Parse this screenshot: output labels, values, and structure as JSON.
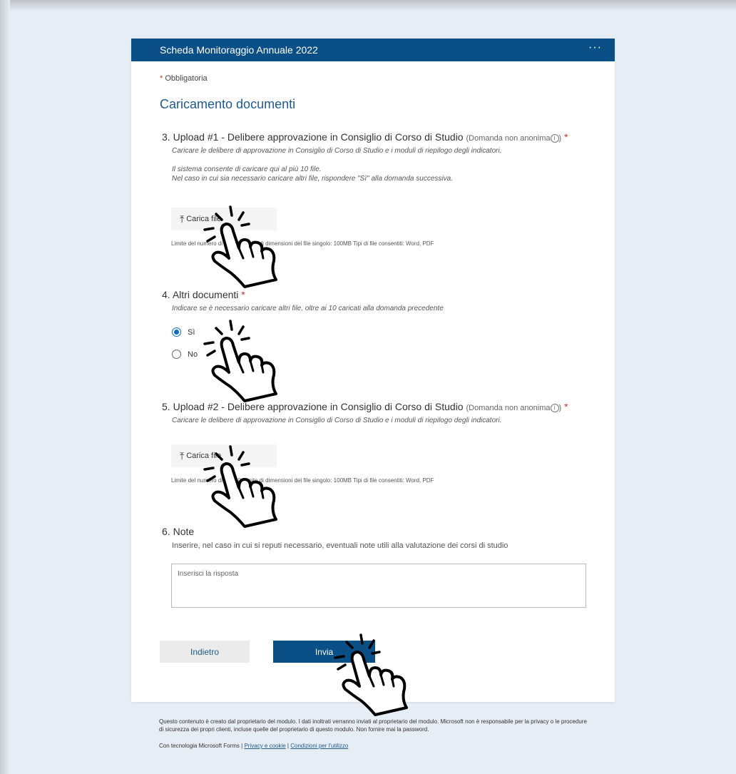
{
  "header": {
    "title": "Scheda Monitoraggio Annuale 2022",
    "more_label": "···"
  },
  "required_note": {
    "star": "*",
    "text": "Obbligatoria"
  },
  "section_title": "Caricamento documenti",
  "questions": [
    {
      "number": "3.",
      "title": "Upload #1 - Delibere approvazione in Consiglio di Corso di Studio",
      "meta": "(Domanda non anonima",
      "meta_close": ")",
      "required": "*",
      "description": [
        "Caricare le delibere di approvazione in Consiglio di Corso di Studio e i moduli di riepilogo degli indicatori.",
        "Il sistema consente di caricare qui al più 10 file.",
        "Nel caso in cui sia necessario caricare altri file, rispondere \"Sì\" alla domanda successiva."
      ],
      "upload_label": "Carica file",
      "limits": "Limite del numero di file: 10   Limite di dimensioni del file singolo: 100MB   Tipi di file consentiti: Word, PDF"
    },
    {
      "number": "4.",
      "title": "Altri documenti",
      "required": "*",
      "description": "Indicare se è necessario caricare altri file, oltre ai 10 caricati alla domanda precedente",
      "options": [
        {
          "label": "Sì",
          "checked": true
        },
        {
          "label": "No",
          "checked": false
        }
      ]
    },
    {
      "number": "5.",
      "title": "Upload #2 - Delibere approvazione in Consiglio di Corso di Studio",
      "meta": "(Domanda non anonima",
      "meta_close": ")",
      "required": "*",
      "description": "Caricare le delibere di approvazione in Consiglio di Corso di Studio e i moduli di riepilogo degli indicatori.",
      "upload_label": "Carica file",
      "limits": "Limite del numero di file: 10   Limite di dimensioni del file singolo: 100MB   Tipi di file consentiti: Word, PDF"
    },
    {
      "number": "6.",
      "title": "Note",
      "description": "Inserire, nel caso in cui si reputi necessario, eventuali note utili alla valutazione dei corsi di studio",
      "placeholder": "Inserisci la risposta"
    }
  ],
  "info_icon": "i",
  "buttons": {
    "back": "Indietro",
    "submit": "Invia"
  },
  "footer": {
    "disclaimer": "Questo contenuto è creato dal proprietario del modulo. I dati inoltrati verranno inviati al proprietario del modulo. Microsoft non è responsabile per la privacy o le procedure di sicurezza dei propri clienti, incluse quelle del proprietario di questo modulo. Non fornire mai la password.",
    "powered_by": "Con tecnologia Microsoft Forms | ",
    "privacy_link": "Privacy e cookie",
    "separator": " | ",
    "terms_link": "Condizioni per l'utilizzo"
  },
  "colors": {
    "brand": "#0b4f87",
    "title_blue": "#1f5a8c",
    "required_red": "#c0392b",
    "radio_blue": "#0f6cbd"
  },
  "icons": {
    "upload": "upload-icon",
    "info": "info-icon",
    "pointer": "pointing-hand-icon"
  }
}
